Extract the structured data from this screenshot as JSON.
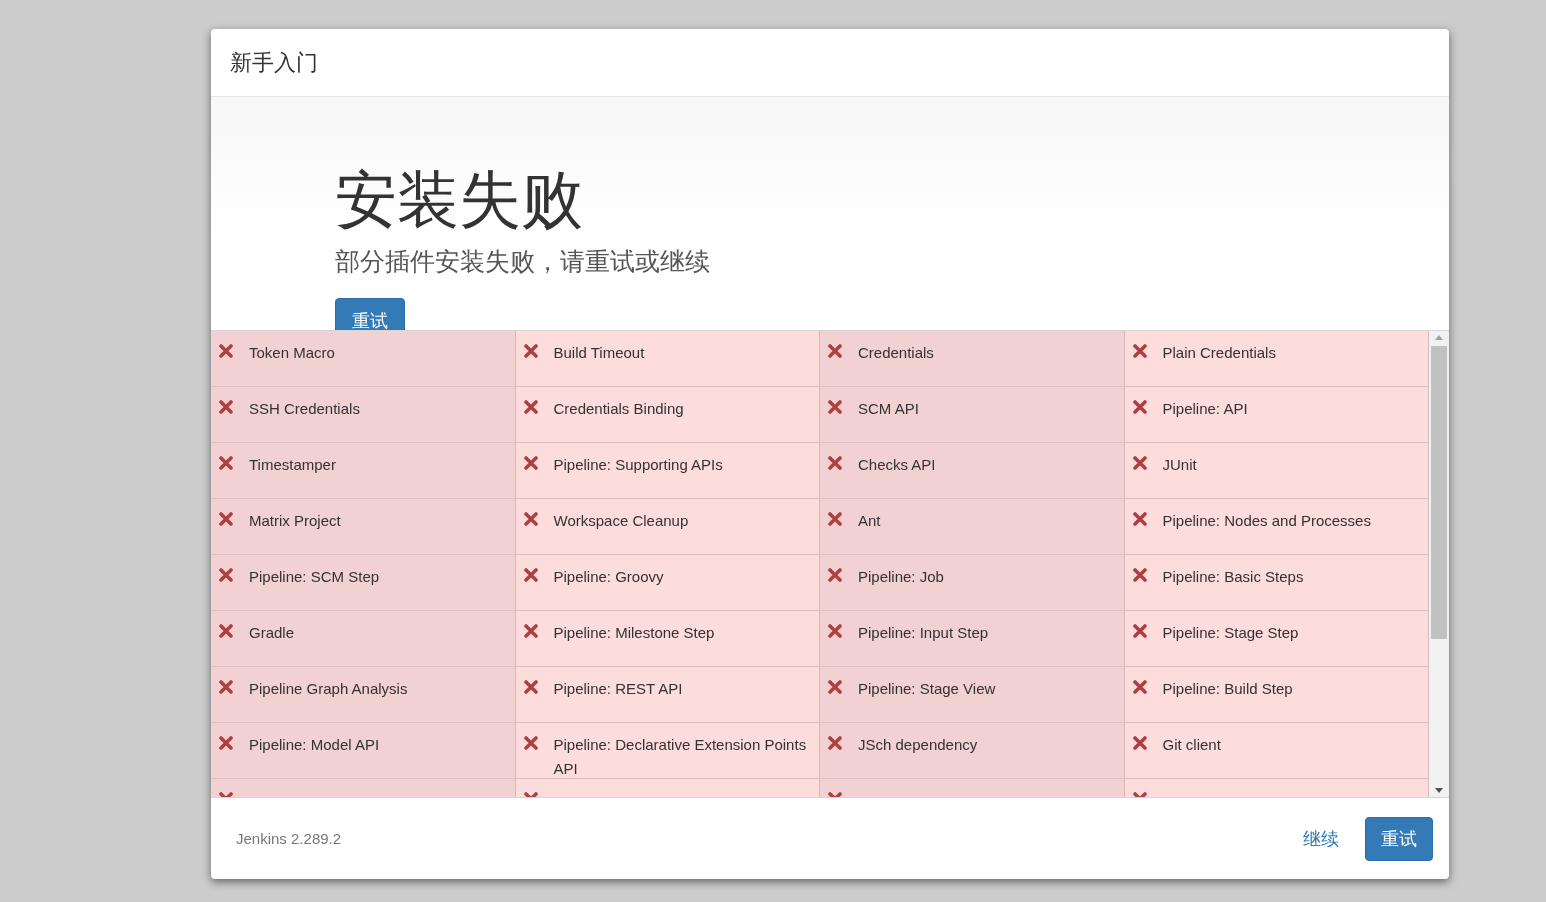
{
  "dialog": {
    "title": "新手入门"
  },
  "hero": {
    "heading": "安装失败",
    "subtitle": "部分插件安装失败，请重试或继续",
    "retry_button": "重试"
  },
  "plugins": [
    {
      "name": "Token Macro",
      "failed": true
    },
    {
      "name": "Build Timeout",
      "failed": true
    },
    {
      "name": "Credentials",
      "failed": true
    },
    {
      "name": "Plain Credentials",
      "failed": true
    },
    {
      "name": "SSH Credentials",
      "failed": true
    },
    {
      "name": "Credentials Binding",
      "failed": true
    },
    {
      "name": "SCM API",
      "failed": true
    },
    {
      "name": "Pipeline: API",
      "failed": true
    },
    {
      "name": "Timestamper",
      "failed": true
    },
    {
      "name": "Pipeline: Supporting APIs",
      "failed": true
    },
    {
      "name": "Checks API",
      "failed": true
    },
    {
      "name": "JUnit",
      "failed": true
    },
    {
      "name": "Matrix Project",
      "failed": true
    },
    {
      "name": "Workspace Cleanup",
      "failed": true
    },
    {
      "name": "Ant",
      "failed": true
    },
    {
      "name": "Pipeline: Nodes and Processes",
      "failed": true
    },
    {
      "name": "Pipeline: SCM Step",
      "failed": true
    },
    {
      "name": "Pipeline: Groovy",
      "failed": true
    },
    {
      "name": "Pipeline: Job",
      "failed": true
    },
    {
      "name": "Pipeline: Basic Steps",
      "failed": true
    },
    {
      "name": "Gradle",
      "failed": true
    },
    {
      "name": "Pipeline: Milestone Step",
      "failed": true
    },
    {
      "name": "Pipeline: Input Step",
      "failed": true
    },
    {
      "name": "Pipeline: Stage Step",
      "failed": true
    },
    {
      "name": "Pipeline Graph Analysis",
      "failed": true
    },
    {
      "name": "Pipeline: REST API",
      "failed": true
    },
    {
      "name": "Pipeline: Stage View",
      "failed": true
    },
    {
      "name": "Pipeline: Build Step",
      "failed": true
    },
    {
      "name": "Pipeline: Model API",
      "failed": true
    },
    {
      "name": "Pipeline: Declarative Extension Points API",
      "failed": true
    },
    {
      "name": "JSch dependency",
      "failed": true
    },
    {
      "name": "Git client",
      "failed": true
    },
    {
      "failed": true
    },
    {
      "failed": true
    },
    {
      "failed": true
    },
    {
      "failed": true
    }
  ],
  "footer": {
    "version": "Jenkins 2.289.2",
    "continue_link": "继续",
    "retry_button": "重试"
  }
}
